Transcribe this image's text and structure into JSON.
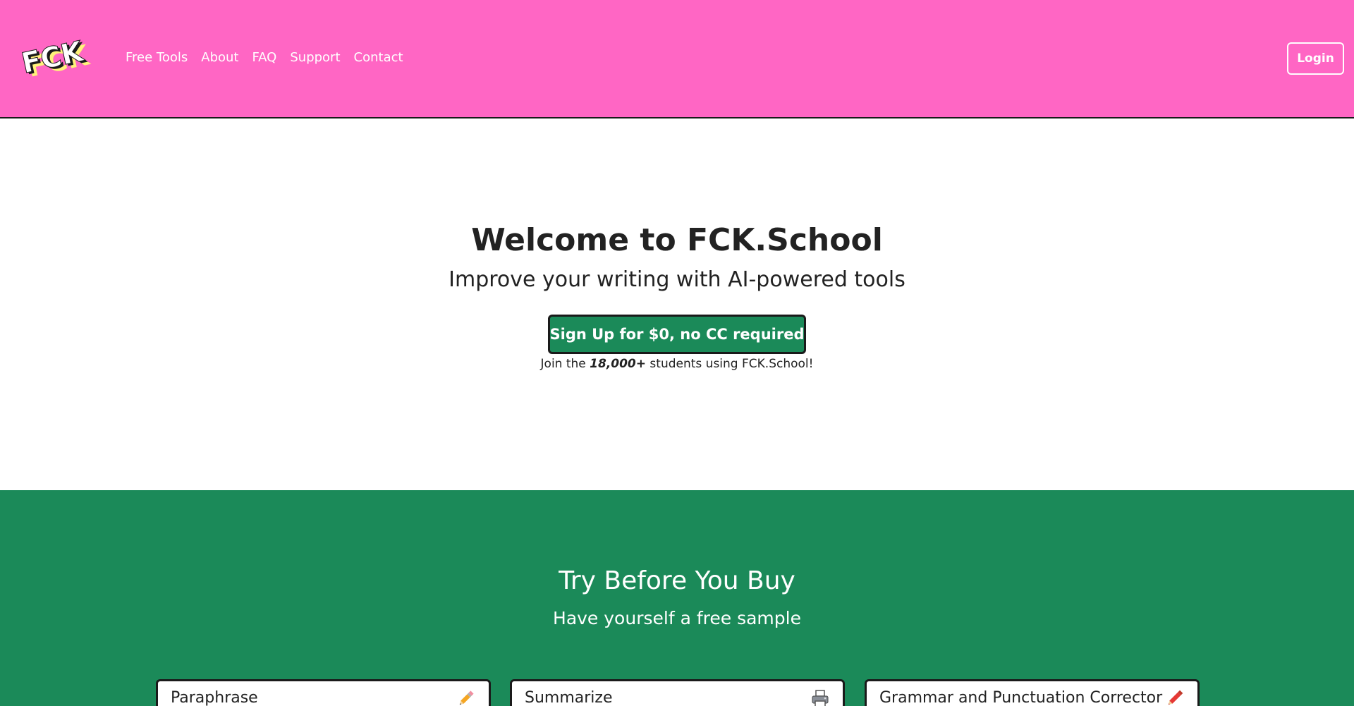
{
  "header": {
    "logo_text": "FCK",
    "nav": [
      {
        "label": "Free Tools"
      },
      {
        "label": "About"
      },
      {
        "label": "FAQ"
      },
      {
        "label": "Support"
      },
      {
        "label": "Contact"
      }
    ],
    "login_label": "Login"
  },
  "hero": {
    "title": "Welcome to FCK.School",
    "subtitle": "Improve your writing with AI-powered tools",
    "signup_label": "Sign Up for $0, no CC required",
    "join_prefix": "Join the",
    "join_count": "18,000+",
    "join_suffix": "students using FCK.School!"
  },
  "sample": {
    "title": "Try Before You Buy",
    "subtitle": "Have yourself a free sample",
    "tools": [
      {
        "label": "Paraphrase",
        "icon": "pencil-icon"
      },
      {
        "label": "Summarize",
        "icon": "printer-icon"
      },
      {
        "label": "Grammar and Punctuation Corrector",
        "icon": "red-pencil-icon"
      }
    ]
  },
  "colors": {
    "header_bg": "#ff66c4",
    "accent_green": "#1b8a59",
    "text_dark": "#222222",
    "logo_yellow": "#fff27a"
  }
}
